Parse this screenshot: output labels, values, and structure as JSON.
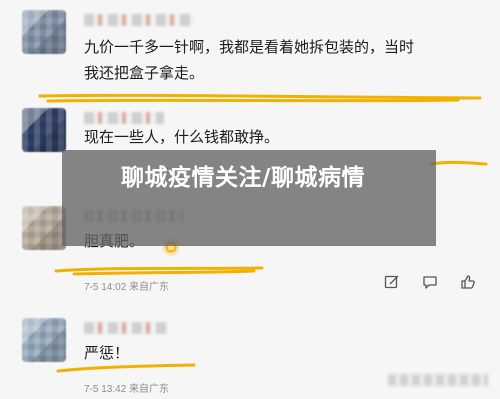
{
  "comments": [
    {
      "lines": [
        "九价一千多一针啊，我都是看着她拆包装的，当时",
        "我还把盒子拿走。"
      ],
      "meta": ""
    },
    {
      "lines": [
        "现在一些人，什么钱都敢挣。"
      ],
      "meta": ""
    },
    {
      "lines": [
        "胆真肥。"
      ],
      "meta": "7-5 14:02 来自广东"
    },
    {
      "lines": [
        "严惩！"
      ],
      "meta": "7-5 13:42 来自广东"
    }
  ],
  "overlay": {
    "title": "聊城疫情关注/聊城病情"
  },
  "icons": [
    "edit-icon",
    "comment-icon",
    "like-icon"
  ],
  "colors": {
    "scribble": "#f2b100",
    "background": "#f6f6f6",
    "overlay": "rgba(100,100,100,0.78)"
  }
}
